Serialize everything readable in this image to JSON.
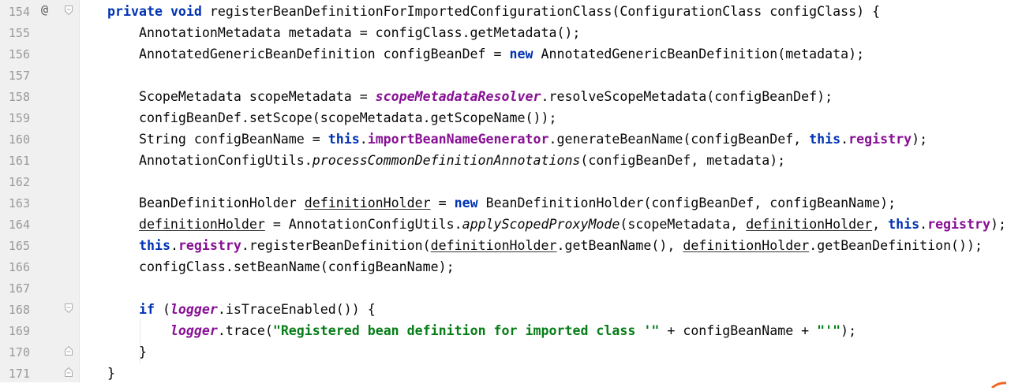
{
  "lines": [
    {
      "num": "154",
      "override": "@",
      "fold": "open",
      "tokens": [
        {
          "t": "private",
          "c": "kw"
        },
        {
          "t": " "
        },
        {
          "t": "void",
          "c": "kw"
        },
        {
          "t": " registerBeanDefinitionForImportedConfigurationClass(ConfigurationClass configClass) {"
        }
      ]
    },
    {
      "num": "155",
      "tokens": [
        {
          "t": "    AnnotationMetadata metadata = configClass.getMetadata();"
        }
      ]
    },
    {
      "num": "156",
      "tokens": [
        {
          "t": "    AnnotatedGenericBeanDefinition configBeanDef = "
        },
        {
          "t": "new",
          "c": "kw"
        },
        {
          "t": " AnnotatedGenericBeanDefinition(metadata);"
        }
      ]
    },
    {
      "num": "157",
      "tokens": []
    },
    {
      "num": "158",
      "tokens": [
        {
          "t": "    ScopeMetadata scopeMetadata = "
        },
        {
          "t": "scopeMetadataResolver",
          "c": "sfld"
        },
        {
          "t": ".resolveScopeMetadata(configBeanDef);"
        }
      ]
    },
    {
      "num": "159",
      "tokens": [
        {
          "t": "    configBeanDef.setScope(scopeMetadata.getScopeName());"
        }
      ]
    },
    {
      "num": "160",
      "tokens": [
        {
          "t": "    String configBeanName = "
        },
        {
          "t": "this",
          "c": "kw"
        },
        {
          "t": "."
        },
        {
          "t": "importBeanNameGenerator",
          "c": "fld"
        },
        {
          "t": ".generateBeanName(configBeanDef, "
        },
        {
          "t": "this",
          "c": "kw"
        },
        {
          "t": "."
        },
        {
          "t": "registry",
          "c": "fld"
        },
        {
          "t": ");"
        }
      ]
    },
    {
      "num": "161",
      "tokens": [
        {
          "t": "    AnnotationConfigUtils."
        },
        {
          "t": "processCommonDefinitionAnnotations",
          "c": "smc"
        },
        {
          "t": "(configBeanDef, metadata);"
        }
      ]
    },
    {
      "num": "162",
      "tokens": []
    },
    {
      "num": "163",
      "tokens": [
        {
          "t": "    BeanDefinitionHolder "
        },
        {
          "t": "definitionHolder",
          "c": "ul"
        },
        {
          "t": " = "
        },
        {
          "t": "new",
          "c": "kw"
        },
        {
          "t": " BeanDefinitionHolder(configBeanDef, configBeanName);"
        }
      ]
    },
    {
      "num": "164",
      "tokens": [
        {
          "t": "    "
        },
        {
          "t": "definitionHolder",
          "c": "ul"
        },
        {
          "t": " = AnnotationConfigUtils."
        },
        {
          "t": "applyScopedProxyMode",
          "c": "smc"
        },
        {
          "t": "(scopeMetadata, "
        },
        {
          "t": "definitionHolder",
          "c": "ul"
        },
        {
          "t": ", "
        },
        {
          "t": "this",
          "c": "kw"
        },
        {
          "t": "."
        },
        {
          "t": "registry",
          "c": "fld"
        },
        {
          "t": ");"
        }
      ]
    },
    {
      "num": "165",
      "tokens": [
        {
          "t": "    "
        },
        {
          "t": "this",
          "c": "kw"
        },
        {
          "t": "."
        },
        {
          "t": "registry",
          "c": "fld"
        },
        {
          "t": ".registerBeanDefinition("
        },
        {
          "t": "definitionHolder",
          "c": "ul"
        },
        {
          "t": ".getBeanName(), "
        },
        {
          "t": "definitionHolder",
          "c": "ul"
        },
        {
          "t": ".getBeanDefinition());"
        }
      ]
    },
    {
      "num": "166",
      "tokens": [
        {
          "t": "    configClass.setBeanName(configBeanName);"
        }
      ]
    },
    {
      "num": "167",
      "tokens": []
    },
    {
      "num": "168",
      "fold": "open",
      "tokens": [
        {
          "t": "    "
        },
        {
          "t": "if",
          "c": "kw"
        },
        {
          "t": " ("
        },
        {
          "t": "logger",
          "c": "sfld"
        },
        {
          "t": ".isTraceEnabled()) {"
        }
      ]
    },
    {
      "num": "169",
      "tokens": [
        {
          "t": "        "
        },
        {
          "t": "logger",
          "c": "sfld"
        },
        {
          "t": ".trace("
        },
        {
          "t": "\"Registered bean definition for imported class '\"",
          "c": "str"
        },
        {
          "t": " + configBeanName + "
        },
        {
          "t": "\"'\"",
          "c": "str"
        },
        {
          "t": ");"
        }
      ]
    },
    {
      "num": "170",
      "fold": "close",
      "tokens": [
        {
          "t": "    }"
        }
      ]
    },
    {
      "num": "171",
      "fold": "close",
      "tokens": [
        {
          "t": "}"
        }
      ]
    }
  ],
  "colors": {
    "keyword": "#0033b3",
    "string": "#067d17",
    "field": "#871094",
    "text": "#080808",
    "line_number": "#999999",
    "gutter_bg": "#f0f0f0"
  },
  "icons": {
    "override": "at-sign-override-icon",
    "fold_open": "fold-open-icon",
    "fold_close": "fold-close-icon"
  }
}
